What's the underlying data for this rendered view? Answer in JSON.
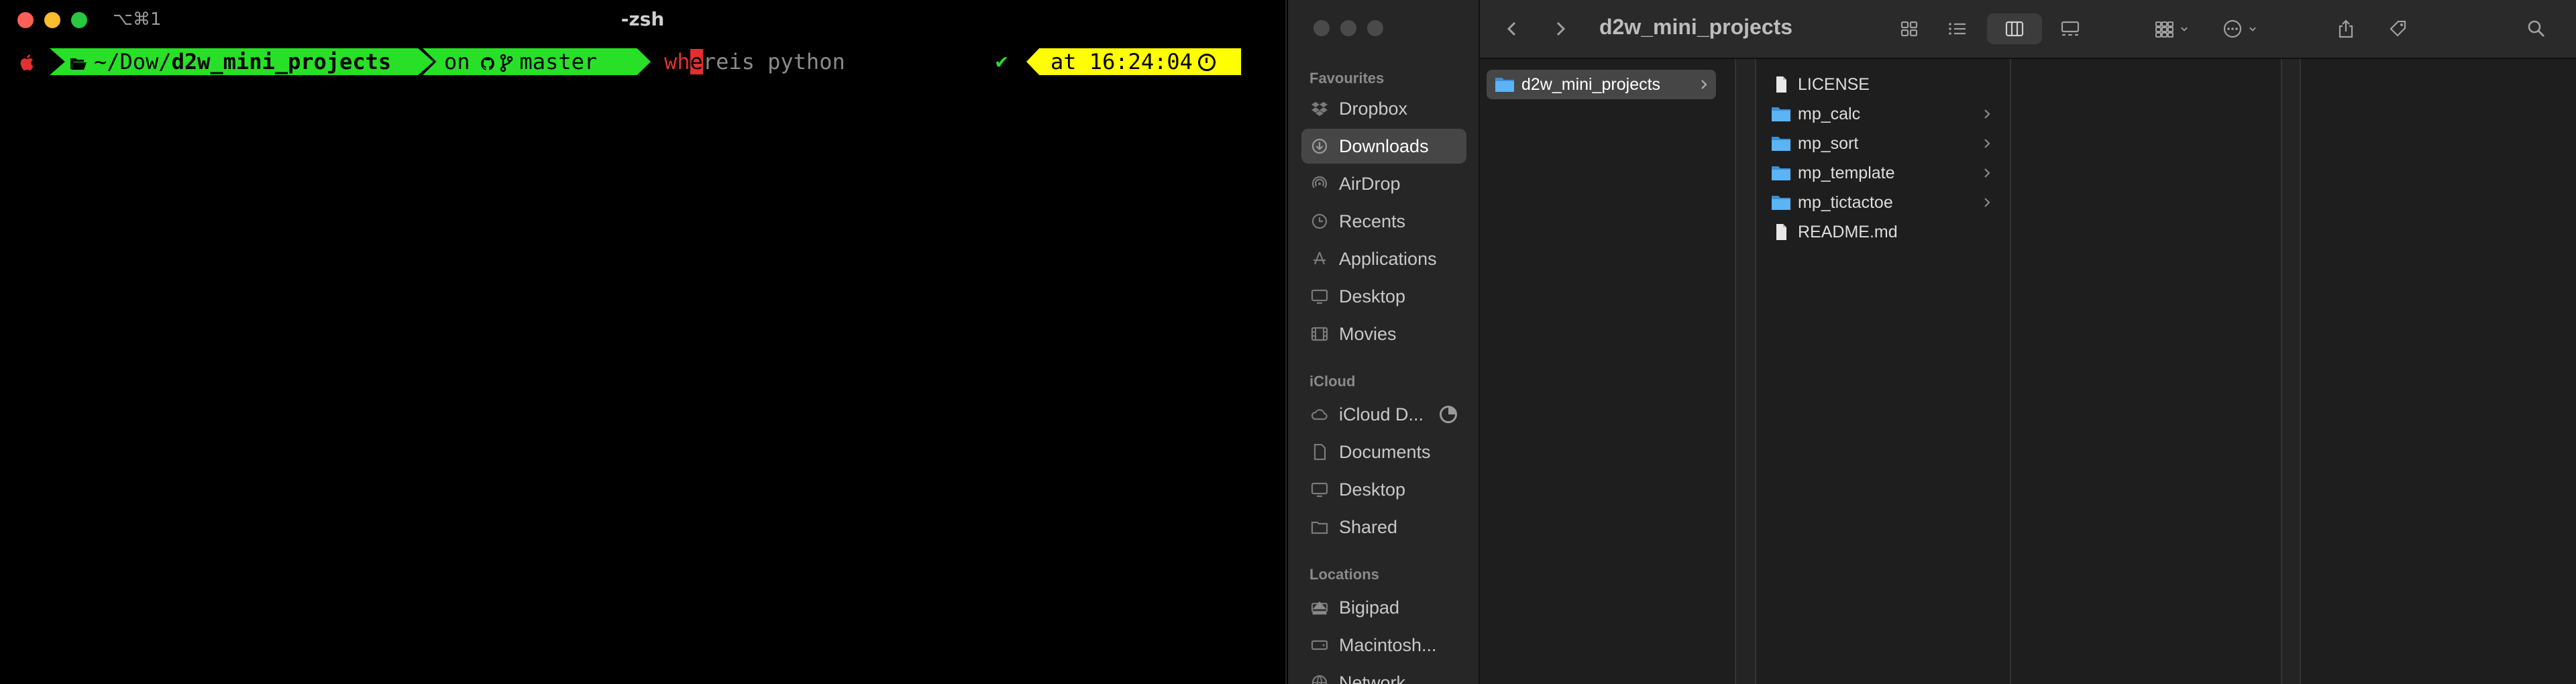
{
  "terminal": {
    "shortcut": "⌥⌘1",
    "title": "-zsh",
    "prompt": {
      "path_prefix": "~/Dow/",
      "path_bold": "d2w_mini_projects",
      "git_on": "on",
      "branch": "master",
      "cmd_typed": "wh",
      "cmd_cursor_char": "e",
      "cmd_rest": "reis python",
      "status_mark": "✔",
      "time_text": "at 16:24:04"
    },
    "colors": {
      "segment_green": "#28e028",
      "segment_yellow": "#ffff00",
      "typed_red": "#e03030"
    }
  },
  "finder": {
    "title": "d2w_mini_projects",
    "sidebar": {
      "favourites_label": "Favourites",
      "favourites": [
        {
          "label": "Dropbox",
          "icon": "dropbox-icon"
        },
        {
          "label": "Downloads",
          "icon": "download-icon",
          "selected": true
        },
        {
          "label": "AirDrop",
          "icon": "airdrop-icon"
        },
        {
          "label": "Recents",
          "icon": "clock-icon"
        },
        {
          "label": "Applications",
          "icon": "applications-icon"
        },
        {
          "label": "Desktop",
          "icon": "desktop-icon"
        },
        {
          "label": "Movies",
          "icon": "film-icon"
        }
      ],
      "icloud_label": "iCloud",
      "icloud": [
        {
          "label": "iCloud D...",
          "icon": "cloud-icon"
        },
        {
          "label": "Documents",
          "icon": "document-icon"
        },
        {
          "label": "Desktop",
          "icon": "desktop-icon"
        },
        {
          "label": "Shared",
          "icon": "shared-folder-icon"
        }
      ],
      "locations_label": "Locations",
      "locations": [
        {
          "label": "Bigipad",
          "icon": "drive-icon"
        },
        {
          "label": "Macintosh...",
          "icon": "drive-icon"
        },
        {
          "label": "Network",
          "icon": "network-icon"
        }
      ]
    },
    "column1": [
      {
        "label": "d2w_mini_projects",
        "type": "folder",
        "selected": true
      }
    ],
    "column2": [
      {
        "label": "LICENSE",
        "type": "file"
      },
      {
        "label": "mp_calc",
        "type": "folder"
      },
      {
        "label": "mp_sort",
        "type": "folder"
      },
      {
        "label": "mp_template",
        "type": "folder"
      },
      {
        "label": "mp_tictactoe",
        "type": "folder"
      },
      {
        "label": "README.md",
        "type": "file"
      }
    ],
    "colors": {
      "folder_blue": "#4aa8f0",
      "background": "#1e1e1e",
      "sidebar": "#262626"
    }
  }
}
